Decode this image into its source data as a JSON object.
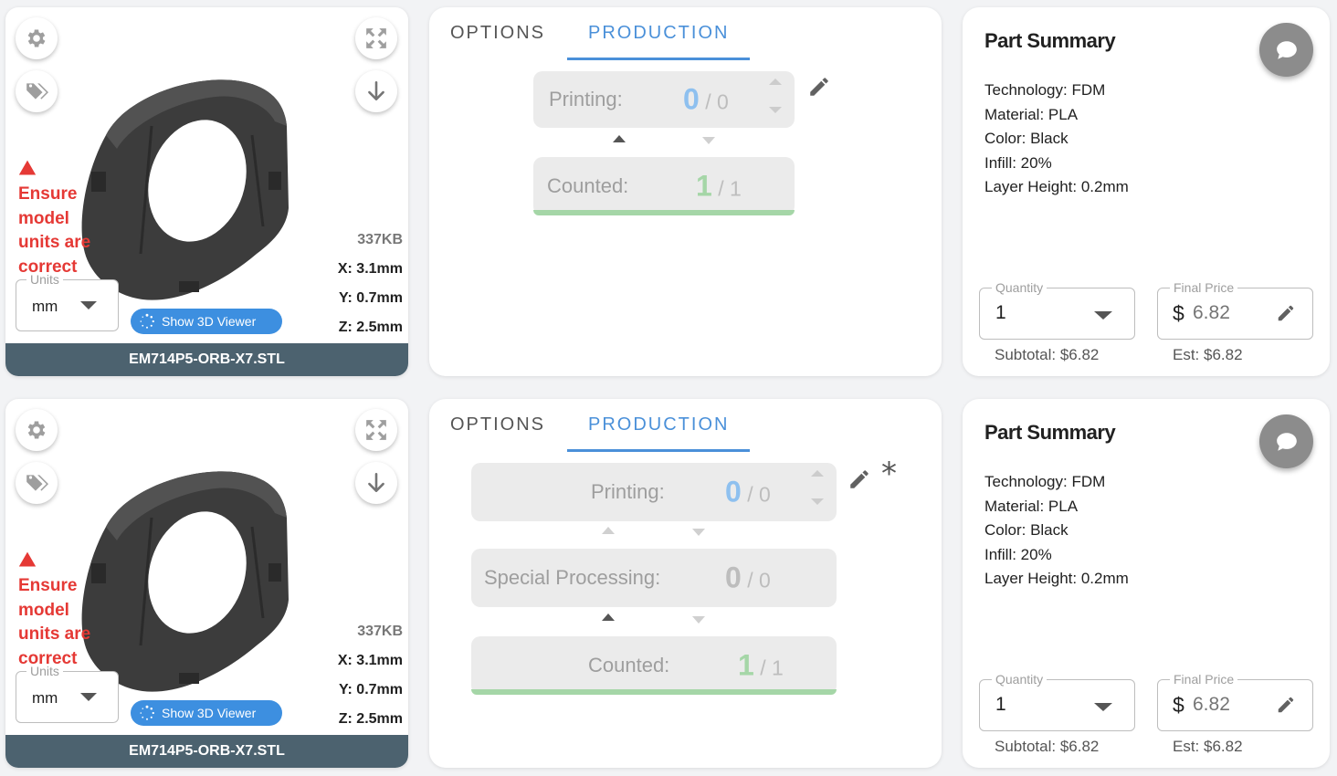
{
  "rows": [
    {
      "model": {
        "warning": "Ensure model units are correct",
        "file_size": "337KB",
        "dim_x": "X: 3.1mm",
        "dim_y": "Y: 0.7mm",
        "dim_z": "Z: 2.5mm",
        "units_legend": "Units",
        "units_value": "mm",
        "viewer_label": "Show 3D Viewer",
        "filename": "EM714P5-ORB-X7.STL"
      },
      "tabs": {
        "options": "OPTIONS",
        "production": "PRODUCTION"
      },
      "stages": [
        {
          "label": "Printing:",
          "done": "0",
          "total": "/ 0"
        },
        {
          "label": "Counted:",
          "done": "1",
          "total": "/ 1"
        }
      ],
      "summary": {
        "title": "Part Summary",
        "specs": [
          "Technology: FDM",
          "Material: PLA",
          "Color: Black",
          "Infill: 20%",
          "Layer Height: 0.2mm"
        ],
        "quantity_legend": "Quantity",
        "quantity_value": "1",
        "price_legend": "Final Price",
        "price_currency": "$",
        "price_value": "6.82",
        "subtotal": "Subtotal: $6.82",
        "est": "Est: $6.82"
      }
    },
    {
      "model": {
        "warning": "Ensure model units are correct",
        "file_size": "337KB",
        "dim_x": "X: 3.1mm",
        "dim_y": "Y: 0.7mm",
        "dim_z": "Z: 2.5mm",
        "units_legend": "Units",
        "units_value": "mm",
        "viewer_label": "Show 3D Viewer",
        "filename": "EM714P5-ORB-X7.STL"
      },
      "tabs": {
        "options": "OPTIONS",
        "production": "PRODUCTION"
      },
      "stages": [
        {
          "label": "Printing:",
          "done": "0",
          "total": "/ 0"
        },
        {
          "label": "Special Processing:",
          "done": "0",
          "total": "/ 0"
        },
        {
          "label": "Counted:",
          "done": "1",
          "total": "/ 1"
        }
      ],
      "asterisk": "*",
      "summary": {
        "title": "Part Summary",
        "specs": [
          "Technology: FDM",
          "Material: PLA",
          "Color: Black",
          "Infill: 20%",
          "Layer Height: 0.2mm"
        ],
        "quantity_legend": "Quantity",
        "quantity_value": "1",
        "price_legend": "Final Price",
        "price_currency": "$",
        "price_value": "6.82",
        "subtotal": "Subtotal: $6.82",
        "est": "Est: $6.82"
      }
    }
  ],
  "icons": {
    "settings": "gear-icon",
    "tags": "tag-icon",
    "expand": "expand-icon",
    "download": "download-icon",
    "warning": "warning-icon",
    "viewer": "spinner-icon",
    "edit": "pencil-icon",
    "chat": "chat-icon"
  },
  "colors": {
    "accent": "#4a90d9",
    "viewer_button": "#3d8fe0",
    "warning": "#e53935",
    "filename_bar": "#4c626f",
    "progress_complete": "#a5d6a7",
    "printing_count": "#8ec0ef",
    "chat_button": "#8c8c8c"
  }
}
